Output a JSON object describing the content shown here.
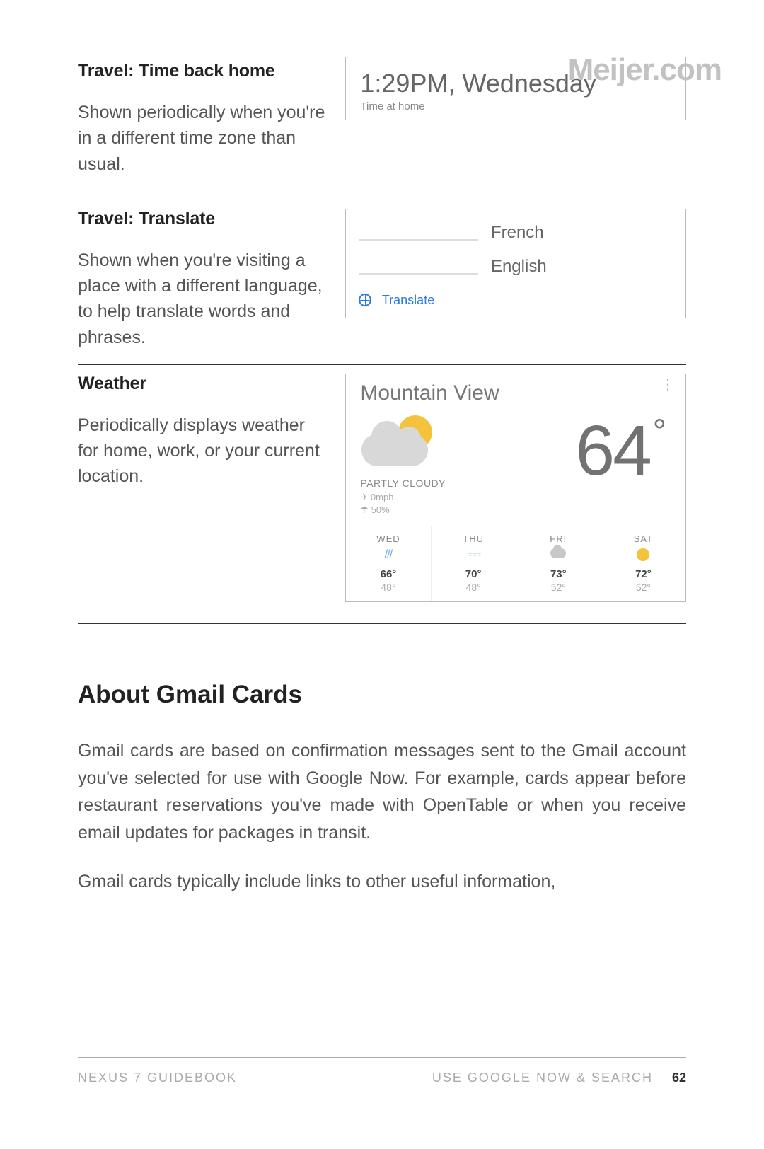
{
  "watermark": "Meijer.com",
  "sections": [
    {
      "title": "Travel: Time back home",
      "desc": "Shown periodically when you're in a different time zone than usual."
    },
    {
      "title": "Travel: Translate",
      "desc": "Shown when you're visiting a place with a different language, to help translate words and phrases."
    },
    {
      "title": "Weather",
      "desc": "Periodically displays weather  for home, work, or your current location."
    }
  ],
  "time_card": {
    "line": "1:29PM, Wednesday",
    "sub": "Time at home"
  },
  "translate_card": {
    "lang1": "French",
    "lang2": "English",
    "action": "Translate"
  },
  "weather_card": {
    "city": "Mountain View",
    "condition": "PARTLY CLOUDY",
    "wind": "0mph",
    "humidity": "50%",
    "temp": "64",
    "forecast": [
      {
        "day": "WED",
        "icon": "rain",
        "hi": "66°",
        "lo": "48°"
      },
      {
        "day": "THU",
        "icon": "fog",
        "hi": "70°",
        "lo": "48°"
      },
      {
        "day": "FRI",
        "icon": "cloud",
        "hi": "73°",
        "lo": "52°"
      },
      {
        "day": "SAT",
        "icon": "sun",
        "hi": "72°",
        "lo": "52°"
      }
    ]
  },
  "about": {
    "heading": "About Gmail Cards",
    "p1": "Gmail cards are based on confirmation messages sent to the Gmail account you've selected for use with Google Now. For example, cards appear before restaurant reservations you've made with OpenTable or when you receive email updates for packages in transit.",
    "p2": "Gmail cards typically include links to other useful information,"
  },
  "footer": {
    "book": "NEXUS 7 GUIDEBOOK",
    "chapter": "USE GOOGLE NOW & SEARCH",
    "page": "62"
  }
}
